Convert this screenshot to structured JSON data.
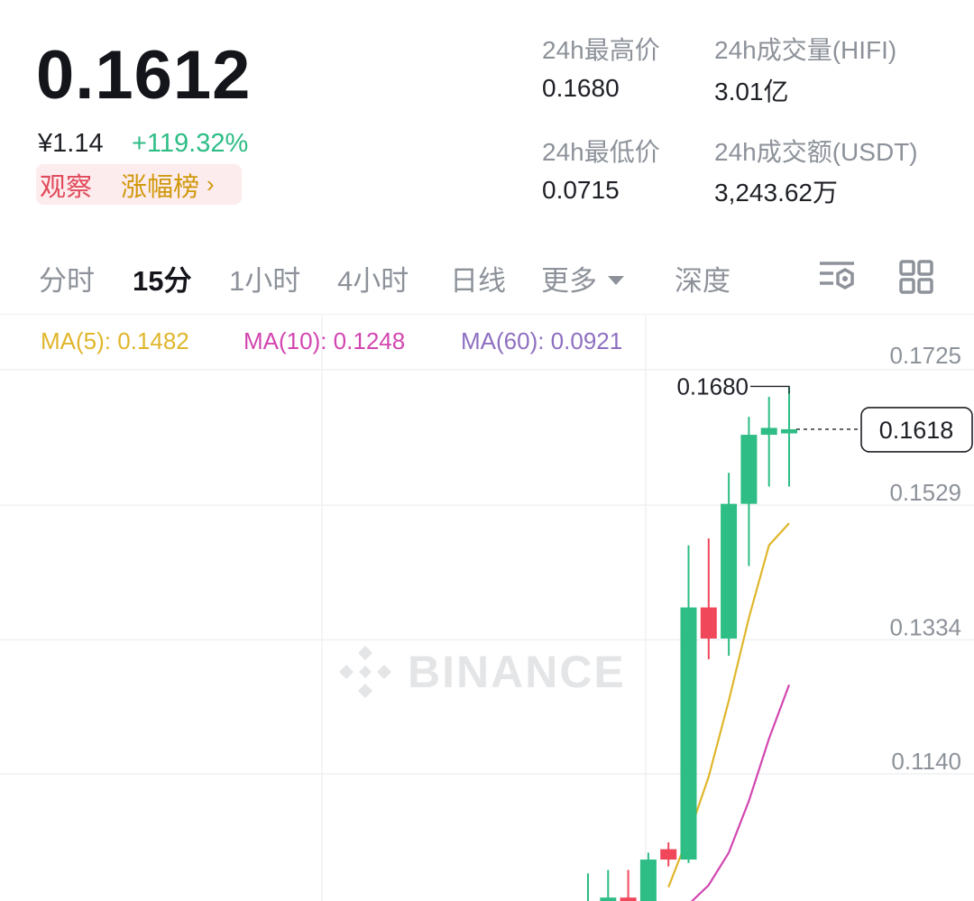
{
  "header": {
    "last_price": "0.1612",
    "fiat_price": "¥1.14",
    "change_pct": "+119.32%",
    "tag_watch": "观察",
    "tag_rank": "涨幅榜",
    "tag_rank_chevron": "›"
  },
  "stats": {
    "high_label": "24h最高价",
    "high_value": "0.1680",
    "low_label": "24h最低价",
    "low_value": "0.0715",
    "volume_label": "24h成交量(HIFI)",
    "volume_value": "3.01亿",
    "turnover_label": "24h成交额(USDT)",
    "turnover_value": "3,243.62万"
  },
  "tabs": [
    {
      "label": "分时",
      "active": false
    },
    {
      "label": "15分",
      "active": true
    },
    {
      "label": "1小时",
      "active": false
    },
    {
      "label": "4小时",
      "active": false
    },
    {
      "label": "日线",
      "active": false
    },
    {
      "label": "更多",
      "active": false
    },
    {
      "label": "深度",
      "active": false
    }
  ],
  "toolbar_icons": [
    "indicator-settings-icon",
    "grid-layout-icon"
  ],
  "ma_legend": [
    {
      "label": "MA(5): 0.1482",
      "color": "#e0b62b"
    },
    {
      "label": "MA(10): 0.1248",
      "color": "#d246b0"
    },
    {
      "label": "MA(60): 0.0921",
      "color": "#8e6fc0"
    }
  ],
  "watermark": "BINANCE",
  "colors": {
    "up": "#2ebd85",
    "down": "#f0475b",
    "accent": "#d0980b"
  },
  "chart_data": {
    "type": "candlestick",
    "interval": "15分",
    "y_ticks": [
      "0.1725",
      "0.1529",
      "0.1334",
      "0.1140"
    ],
    "y_tick_values": [
      0.1725,
      0.1529,
      0.1334,
      0.114
    ],
    "ylim": [
      0.0935,
      0.1725
    ],
    "current_price_label": "0.1618",
    "current_price": 0.1618,
    "high_marker_label": "0.1680",
    "high_marker": 0.168,
    "candles": [
      {
        "open": 0.0915,
        "close": 0.0925,
        "high": 0.0975,
        "low": 0.09
      },
      {
        "open": 0.093,
        "close": 0.094,
        "high": 0.098,
        "low": 0.091
      },
      {
        "open": 0.094,
        "close": 0.0935,
        "high": 0.098,
        "low": 0.092
      },
      {
        "open": 0.0935,
        "close": 0.0995,
        "high": 0.1005,
        "low": 0.092
      },
      {
        "open": 0.101,
        "close": 0.0995,
        "high": 0.102,
        "low": 0.0985
      },
      {
        "open": 0.0995,
        "close": 0.136,
        "high": 0.145,
        "low": 0.099
      },
      {
        "open": 0.136,
        "close": 0.1315,
        "high": 0.146,
        "low": 0.1285
      },
      {
        "open": 0.1315,
        "close": 0.151,
        "high": 0.1555,
        "low": 0.129
      },
      {
        "open": 0.151,
        "close": 0.161,
        "high": 0.1636,
        "low": 0.142
      },
      {
        "open": 0.161,
        "close": 0.162,
        "high": 0.1665,
        "low": 0.1535
      },
      {
        "open": 0.1612,
        "close": 0.1618,
        "high": 0.168,
        "low": 0.1535
      }
    ],
    "ma5": [
      null,
      null,
      null,
      null,
      0.0955,
      0.103,
      0.1115,
      0.1225,
      0.1345,
      0.145,
      0.1482
    ],
    "ma10": [
      null,
      null,
      null,
      null,
      null,
      0.093,
      0.0958,
      0.1005,
      0.108,
      0.117,
      0.1248
    ]
  }
}
